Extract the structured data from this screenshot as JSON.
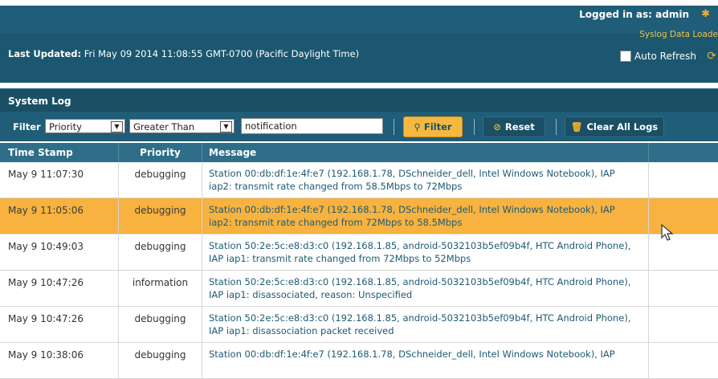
{
  "header": {
    "logged_in_label": "Logged in as: admin",
    "syslog_loader": "Syslog Data Loade",
    "last_updated_label": "Last Updated:",
    "last_updated_value": "Fri May 09 2014 11:08:55 GMT-0700 (Pacific Daylight Time)",
    "auto_refresh_label": "Auto Refresh",
    "auto_refresh_checked": false
  },
  "panel": {
    "title": "System Log"
  },
  "filter": {
    "label": "Filter",
    "field_value": "Priority",
    "operator_value": "Greater Than",
    "text_value": "notification",
    "filter_button": "Filter",
    "reset_button": "Reset",
    "clear_button": "Clear All Logs"
  },
  "table": {
    "columns": [
      "Time Stamp",
      "Priority",
      "Message"
    ],
    "rows": [
      {
        "time": "May 9 11:07:30",
        "priority": "debugging",
        "message_line1": "Station 00:db:df:1e:4f:e7 (192.168.1.78, DSchneider_dell, Intel Windows Notebook), IAP",
        "message_line2": "iap2: transmit rate changed from 58.5Mbps to 72Mbps"
      },
      {
        "time": "May 9 11:05:06",
        "priority": "debugging",
        "message_line1": "Station 00:db:df:1e:4f:e7 (192.168.1.78, DSchneider_dell, Intel Windows Notebook), IAP",
        "message_line2": "iap2: transmit rate changed from 72Mbps to 58.5Mbps"
      },
      {
        "time": "May 9 10:49:03",
        "priority": "debugging",
        "message_line1": "Station 50:2e:5c:e8:d3:c0 (192.168.1.85, android-5032103b5ef09b4f, HTC Android Phone),",
        "message_line2": "IAP iap1: transmit rate changed from 72Mbps to 52Mbps"
      },
      {
        "time": "May 9 10:47:26",
        "priority": "information",
        "message_line1": "Station 50:2e:5c:e8:d3:c0 (192.168.1.85, android-5032103b5ef09b4f, HTC Android Phone),",
        "message_line2": "IAP iap1: disassociated, reason: Unspecified"
      },
      {
        "time": "May 9 10:47:26",
        "priority": "debugging",
        "message_line1": "Station 50:2e:5c:e8:d3:c0 (192.168.1.85, android-5032103b5ef09b4f, HTC Android Phone),",
        "message_line2": "IAP iap1: disassociation packet received"
      },
      {
        "time": "May 9 10:38:06",
        "priority": "debugging",
        "message_line1": "Station 00:db:df:1e:4f:e7 (192.168.1.78, DSchneider_dell, Intel Windows Notebook), IAP",
        "message_line2": ""
      }
    ],
    "selected_row_index": 1
  },
  "colors": {
    "header_bg": "#1f5d78",
    "accent": "#f5b942",
    "selected_row": "#f7b23f"
  },
  "icons": [
    "gear-icon",
    "refresh-icon",
    "search-icon",
    "reset-icon",
    "trash-icon",
    "dropdown-arrow-icon",
    "mouse-pointer-icon"
  ]
}
